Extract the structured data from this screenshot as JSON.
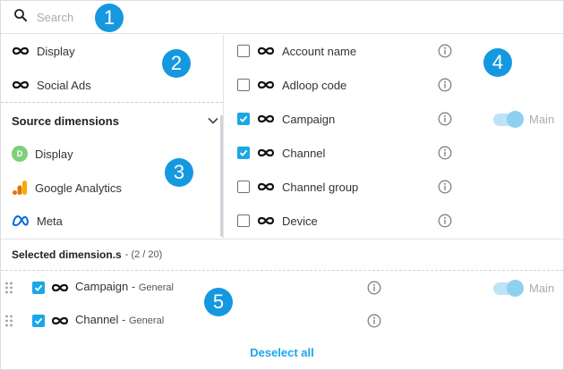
{
  "colors": {
    "accent": "#1aa7e8",
    "badge": "#1598e0",
    "display_badge": "#7ed07b",
    "toggle_track": "#bde3f6",
    "toggle_knob": "#8fd0f0"
  },
  "search": {
    "placeholder": "Search",
    "icon": "search-icon"
  },
  "left": {
    "top_items": [
      {
        "label": "Display",
        "icon": "infinity-icon"
      },
      {
        "label": "Social Ads",
        "icon": "infinity-icon"
      }
    ],
    "section_title": "Source dimensions",
    "sources": [
      {
        "label": "Display",
        "icon": "display-d-icon",
        "badge_letter": "D"
      },
      {
        "label": "Google Analytics",
        "icon": "google-analytics-icon"
      },
      {
        "label": "Meta",
        "icon": "meta-icon"
      }
    ]
  },
  "dimensions": [
    {
      "label": "Account name",
      "checked": false
    },
    {
      "label": "Adloop code",
      "checked": false
    },
    {
      "label": "Campaign",
      "checked": true,
      "toggle_label": "Main"
    },
    {
      "label": "Channel",
      "checked": true
    },
    {
      "label": "Channel group",
      "checked": false
    },
    {
      "label": "Device",
      "checked": false
    }
  ],
  "selected": {
    "title": "Selected dimension.s",
    "count": "- (2 / 20)",
    "items": [
      {
        "label": "Campaign",
        "dash": " - ",
        "category": "General",
        "checked": true,
        "toggle_label": "Main"
      },
      {
        "label": "Channel",
        "dash": " - ",
        "category": "General",
        "checked": true
      }
    ]
  },
  "deselect_all": "Deselect all",
  "badges": [
    "1",
    "2",
    "3",
    "4",
    "5"
  ]
}
